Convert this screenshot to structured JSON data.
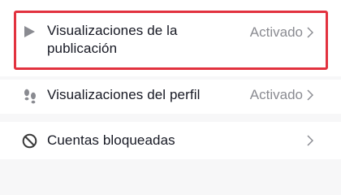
{
  "settings": {
    "items": [
      {
        "label": "Visualizaciones de la publicación",
        "value": "Activado",
        "icon": "play-icon",
        "highlighted": true,
        "highlight_color": "#e2323f"
      },
      {
        "label": "Visualizaciones del perfil",
        "value": "Activado",
        "icon": "footprints-icon"
      },
      {
        "label": "Cuentas bloqueadas",
        "value": "",
        "icon": "block-icon"
      }
    ]
  }
}
